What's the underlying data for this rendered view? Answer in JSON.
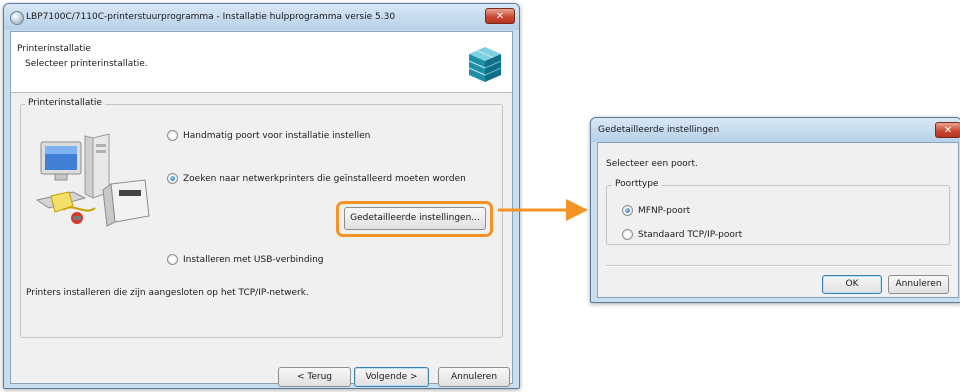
{
  "main_window": {
    "title": "LBP7100C/7110C-printerstuurprogramma - Installatie hulpprogramma versie 5.30",
    "close_label": "✕",
    "header": {
      "title": "Printerinstallatie",
      "subtitle": "Selecteer printerinstallatie."
    },
    "group_label": "Printerinstallatie",
    "options": [
      {
        "label": "Handmatig poort voor installatie instellen",
        "checked": false
      },
      {
        "label": "Zoeken naar netwerkprinters die geïnstalleerd moeten worden",
        "checked": true
      },
      {
        "label": "Installeren met USB-verbinding",
        "checked": false
      }
    ],
    "detailed_settings_label": "Gedetailleerde instellingen...",
    "status_text": "Printers installeren die zijn aangesloten op het TCP/IP-netwerk.",
    "buttons": {
      "back": "< Terug",
      "next": "Volgende >",
      "cancel": "Annuleren"
    }
  },
  "detail_dialog": {
    "title": "Gedetailleerde instellingen",
    "close_label": "✕",
    "instruction": "Selecteer een poort.",
    "group_label": "Poorttype",
    "options": [
      {
        "label": "MFNP-poort",
        "checked": true
      },
      {
        "label": "Standaard TCP/IP-poort",
        "checked": false
      }
    ],
    "buttons": {
      "ok": "OK",
      "cancel": "Annuleren"
    }
  },
  "colors": {
    "highlight": "#f39325",
    "window_frame": "#c9dff0",
    "client_bg": "#f0f0f0"
  },
  "icons": [
    "installer-app-icon",
    "printer-cube-icon",
    "computer-printer-illustration",
    "arrow-right-icon"
  ]
}
